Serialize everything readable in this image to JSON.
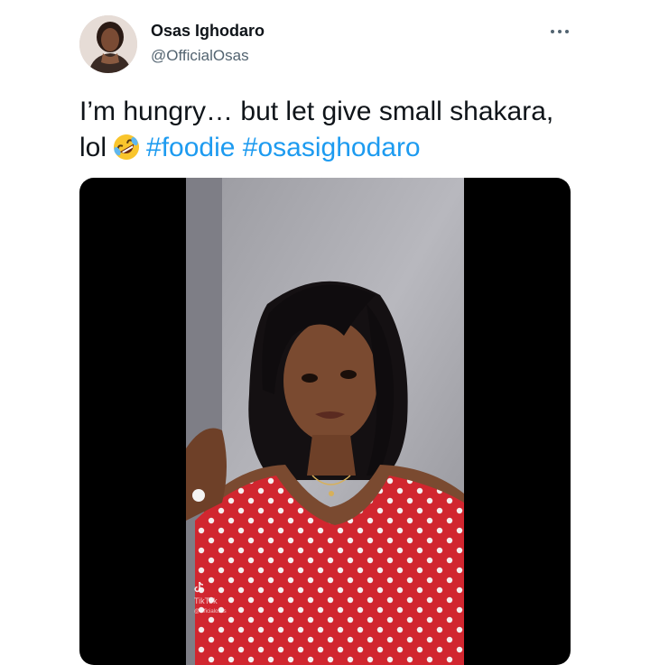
{
  "author": {
    "display_name": "Osas Ighodaro",
    "handle": "@OfficialOsas",
    "avatar_icon": "profile-photo"
  },
  "header": {
    "more_icon": "more-horizontal-icon"
  },
  "tweet": {
    "line1": "I’m hungry… but let give small shakara,",
    "line2_prefix": "lol",
    "emoji": "rolling-on-the-floor-laughing-emoji",
    "hashtags": [
      "#foodie",
      "#osasighodaro"
    ]
  },
  "media": {
    "type": "video-thumbnail",
    "watermark": {
      "brand": "TikTok",
      "user": "@officialosas"
    }
  },
  "colors": {
    "link": "#1d9bf0",
    "text": "#0f1419",
    "secondary": "#536471",
    "media_bg": "#000000",
    "dress": "#d1262f"
  }
}
